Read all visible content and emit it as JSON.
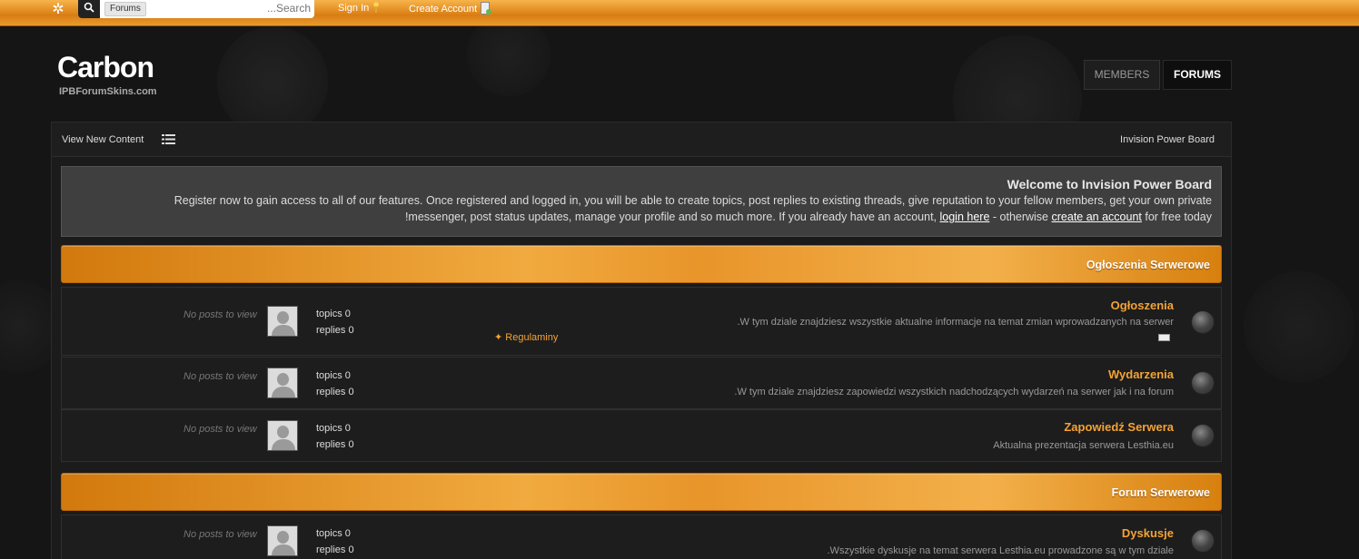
{
  "topbar": {
    "search_scope": "Forums",
    "search_placeholder": "...Search",
    "sign_in": "Sign In",
    "create_account": "Create Account"
  },
  "header": {
    "logo": "Carbon",
    "logo_sub": "IPBForumSkins.com",
    "tabs": [
      "MEMBERS",
      "FORUMS"
    ]
  },
  "subnav": {
    "view_new_content": "View New Content",
    "breadcrumb": "Invision Power Board"
  },
  "welcome": {
    "title": "Welcome to Invision Power Board",
    "line1": "Register now to gain access to all of our features. Once registered and logged in, you will be able to create topics, post replies to existing threads, give reputation to your fellow members, get your own private",
    "line2_pre": "!messenger, post status updates, manage your profile and so much more. If you already have an account, ",
    "login_link": "login here",
    "mid": " - otherwise ",
    "create_link": "create an account",
    "post": " for free today"
  },
  "categories": [
    {
      "title": "Ogłoszenia Serwerowe",
      "forums": [
        {
          "name": "Ogłoszenia",
          "desc": ".W tym dziale znajdziesz wszystkie aktualne informacje na temat zmian wprowadzanych na serwer",
          "topics": "topics 0",
          "replies": "replies 0",
          "last": "No posts to view",
          "subforum": "Regulaminy"
        },
        {
          "name": "Wydarzenia",
          "desc": ".W tym dziale znajdziesz zapowiedzi wszystkich nadchodzących wydarzeń na serwer jak i na forum",
          "topics": "topics 0",
          "replies": "replies 0",
          "last": "No posts to view"
        },
        {
          "name": "Zapowiedź Serwera",
          "desc": "Aktualna prezentacja serwera Lesthia.eu",
          "topics": "topics 0",
          "replies": "replies 0",
          "last": "No posts to view"
        }
      ]
    },
    {
      "title": "Forum Serwerowe",
      "forums": [
        {
          "name": "Dyskusje",
          "desc": ".Wszystkie dyskusje na temat serwera Lesthia.eu prowadzone są w tym dziale",
          "topics": "topics 0",
          "replies": "replies 0",
          "last": "No posts to view"
        }
      ]
    }
  ]
}
